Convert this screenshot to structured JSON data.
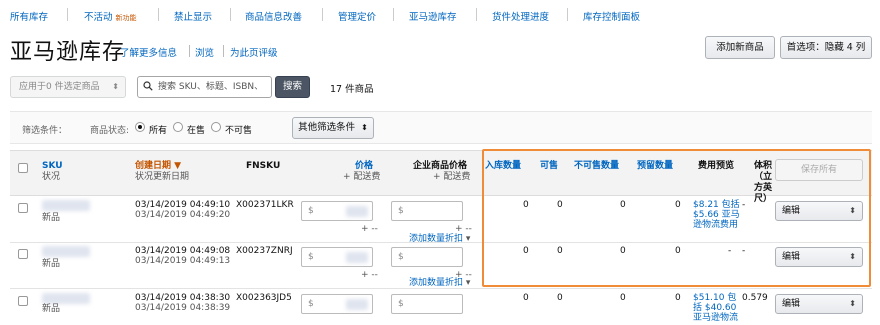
{
  "nav": {
    "items": [
      "所有库存",
      "不活动",
      "禁止显示",
      "商品信息改善",
      "管理定价",
      "亚马逊库存",
      "货件处理进度",
      "库存控制面板"
    ],
    "new_tag": "新功能"
  },
  "header": {
    "title": "亚马逊库存",
    "learn_more": "了解更多信息",
    "browse": "浏览",
    "rate_page": "为此页评级",
    "add_product": "添加新商品",
    "preferences": "首选项：隐藏 4 列"
  },
  "toolbar": {
    "bulk_action": "应用于0 件选定商品",
    "search_placeholder": "搜索 SKU、标题、ISBN、",
    "search_button": "搜索",
    "item_count": "17 件商品"
  },
  "filters": {
    "label": "筛选条件：",
    "status_label": "商品状态:",
    "options": [
      "所有",
      "在售",
      "不可售"
    ],
    "selected": "所有",
    "more_filters": "其他筛选条件"
  },
  "table": {
    "headers": {
      "sku": "SKU",
      "sku_sub": "状况",
      "date": "创建日期",
      "date_sub": "状况更新日期",
      "fnsku": "FNSKU",
      "price": "价格",
      "price_sub": "+ 配送费",
      "business_price": "企业商品价格",
      "business_sub": "+ 配送费",
      "inbound": "入库数量",
      "available": "可售",
      "unsellable": "不可售数量",
      "reserved": "预留数量",
      "fee_preview": "费用预览",
      "volume": "体积（立方英尺）"
    },
    "save_all": "保存所有",
    "currency": "$",
    "plus_placeholder": "+ --",
    "quantity_discount": "添加数量折扣",
    "edit_label": "编辑",
    "rows": [
      {
        "condition": "新品",
        "created": "03/14/2019 04:49:10",
        "updated": "03/14/2019 04:49:20",
        "fnsku": "X002371LKR",
        "inbound": "0",
        "available": "0",
        "unsellable": "0",
        "reserved": "0",
        "fee": [
          "$8.21 包括",
          "$5.66 亚马",
          "逊物流费用"
        ],
        "volume": "-"
      },
      {
        "condition": "新品",
        "created": "03/14/2019 04:49:08",
        "updated": "03/14/2019 04:49:13",
        "fnsku": "X00237ZNRJ",
        "inbound": "0",
        "available": "0",
        "unsellable": "0",
        "reserved": "0",
        "fee": [
          "-"
        ],
        "volume": "-"
      },
      {
        "condition": "新品",
        "created": "03/14/2019 04:38:30",
        "updated": "03/14/2019 04:38:39",
        "fnsku": "X002363JD5",
        "inbound": "0",
        "available": "0",
        "unsellable": "0",
        "reserved": "0",
        "fee": [
          "$51.10 包",
          "括 $40.60",
          "亚马逊物流"
        ],
        "volume": "0.579"
      }
    ]
  }
}
